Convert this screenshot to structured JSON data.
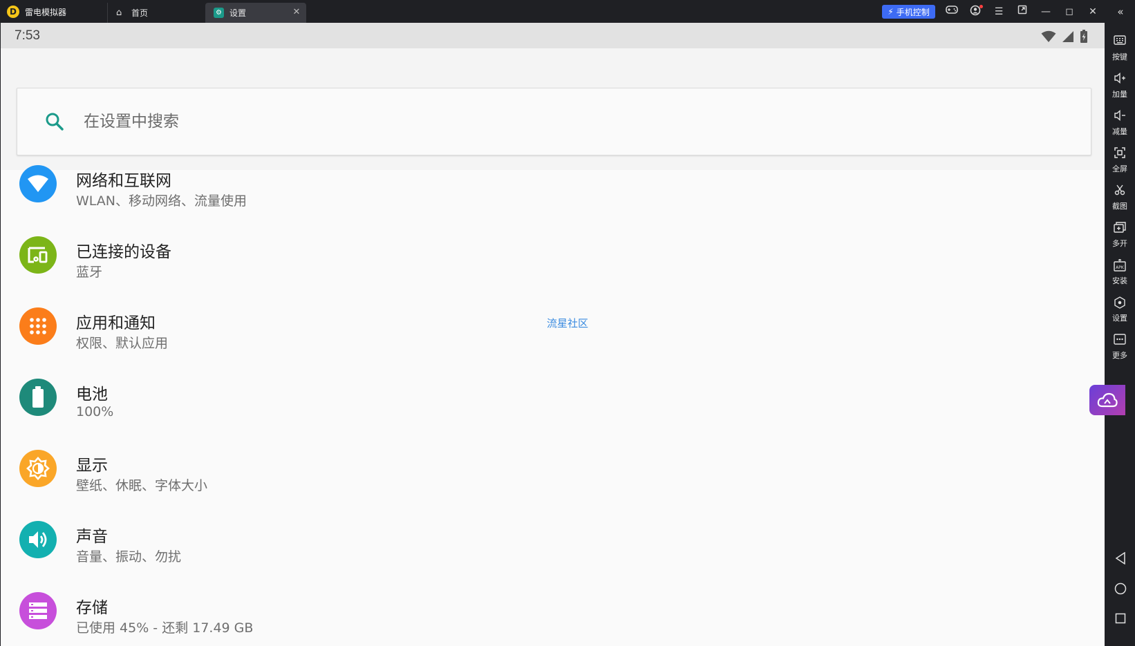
{
  "window": {
    "app_name": "雷电模拟器",
    "logo_letter": "D",
    "tabs": [
      {
        "label": "首页"
      },
      {
        "label": "设置"
      }
    ],
    "phone_control_label": "手机控制"
  },
  "statusbar": {
    "time": "7:53"
  },
  "search": {
    "placeholder": "在设置中搜索"
  },
  "settings_items": [
    {
      "title": "网络和互联网",
      "subtitle": "WLAN、移动网络、流量使用",
      "icon": "wifi-icon",
      "color": "#2196f3"
    },
    {
      "title": "已连接的设备",
      "subtitle": "蓝牙",
      "icon": "devices-icon",
      "color": "#7cb518"
    },
    {
      "title": "应用和通知",
      "subtitle": "权限、默认应用",
      "icon": "apps-grid-icon",
      "color": "#fb7d1a"
    },
    {
      "title": "电池",
      "subtitle": "100%",
      "icon": "battery-icon",
      "color": "#1e8a7a"
    },
    {
      "title": "显示",
      "subtitle": "壁纸、休眠、字体大小",
      "icon": "brightness-icon",
      "color": "#faa628"
    },
    {
      "title": "声音",
      "subtitle": "音量、振动、勿扰",
      "icon": "volume-icon",
      "color": "#13b0b0"
    },
    {
      "title": "存储",
      "subtitle": "已使用 45% - 还剩 17.49 GB",
      "icon": "storage-icon",
      "color": "#c74fdb"
    }
  ],
  "watermark": "流星社区",
  "sidebar": {
    "buttons": [
      {
        "label": "按键",
        "icon": "keyboard-icon"
      },
      {
        "label": "加量",
        "icon": "volume-up-icon"
      },
      {
        "label": "减量",
        "icon": "volume-down-icon"
      },
      {
        "label": "全屏",
        "icon": "fullscreen-icon"
      },
      {
        "label": "截图",
        "icon": "scissors-icon"
      },
      {
        "label": "多开",
        "icon": "multi-instance-icon"
      },
      {
        "label": "安装",
        "icon": "apk-install-icon"
      },
      {
        "label": "设置",
        "icon": "settings-icon"
      },
      {
        "label": "更多",
        "icon": "more-icon"
      }
    ]
  }
}
